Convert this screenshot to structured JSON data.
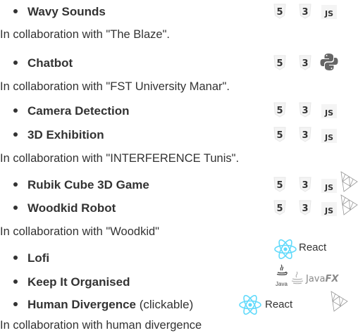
{
  "projects": [
    {
      "title": "Wavy Sounds",
      "collab": "In collaboration with \"The Blaze\".",
      "icons": [
        "html5-icon",
        "css3-icon",
        "javascript-icon"
      ]
    },
    {
      "title": "Chatbot",
      "collab": "In collaboration with \"FST University Manar\".",
      "icons": [
        "html5-icon",
        "css3-icon",
        "python-icon"
      ]
    },
    {
      "title": "Camera Detection",
      "icons": [
        "html5-icon",
        "css3-icon",
        "javascript-icon"
      ]
    },
    {
      "title": "3D Exhibition",
      "collab": "In collaboration with \"INTERFERENCE Tunis\".",
      "icons": [
        "html5-icon",
        "css3-icon",
        "javascript-icon"
      ]
    },
    {
      "title": "Rubik Cube 3D Game",
      "icons": [
        "html5-icon",
        "css3-icon",
        "javascript-icon",
        "threejs-icon"
      ]
    },
    {
      "title": "Woodkid Robot",
      "collab": "In collaboration with \"Woodkid\"",
      "icons": [
        "html5-icon",
        "css3-icon",
        "javascript-icon",
        "threejs-icon"
      ]
    },
    {
      "title": "Lofi",
      "icons": [
        "react-icon"
      ],
      "icon_text": "React"
    },
    {
      "title": "Keep It Organised",
      "icons": [
        "java-icon",
        "javafx-icon"
      ],
      "java_label": "Java",
      "javafx_text": "Java",
      "javafx_suffix": "FX"
    },
    {
      "title": "Human Divergence",
      "title_suffix": "(clickable)",
      "icons": [
        "react-icon",
        "threejs-icon"
      ],
      "icon_text": "React",
      "collab": "In collaboration with human divergence"
    }
  ],
  "icon_glyphs": {
    "html5": "5",
    "css3": "3",
    "javascript": "JS"
  },
  "colors": {
    "text": "#333333",
    "icon": "#333333",
    "react": "#61dafb",
    "python": "#666666",
    "java": "#888888"
  }
}
